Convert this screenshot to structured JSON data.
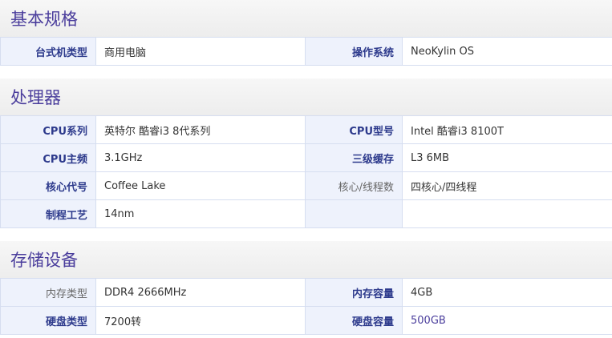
{
  "sections": [
    {
      "title": "基本规格",
      "rows": [
        {
          "k1": "台式机类型",
          "v1": "商用电脑",
          "k2": "操作系统",
          "v2": "NeoKylin OS"
        }
      ]
    },
    {
      "title": "处理器",
      "rows": [
        {
          "k1": "CPU系列",
          "v1": "英特尔 酷睿i3 8代系列",
          "k2": "CPU型号",
          "v2": "Intel 酷睿i3 8100T"
        },
        {
          "k1": "CPU主频",
          "v1": "3.1GHz",
          "k2": "三级缓存",
          "v2": "L3 6MB"
        },
        {
          "k1": "核心代号",
          "v1": "Coffee Lake",
          "k2": "核心/线程数",
          "v2": "四核心/四线程"
        },
        {
          "k1": "制程工艺",
          "v1": "14nm",
          "k2": "",
          "v2": ""
        }
      ]
    },
    {
      "title": "存储设备",
      "rows": [
        {
          "k1": "内存类型",
          "v1": "DDR4 2666MHz",
          "k2": "内存容量",
          "v2": "4GB"
        },
        {
          "k1": "硬盘类型",
          "v1": "7200转",
          "k2": "硬盘容量",
          "v2": "500GB"
        }
      ]
    }
  ]
}
